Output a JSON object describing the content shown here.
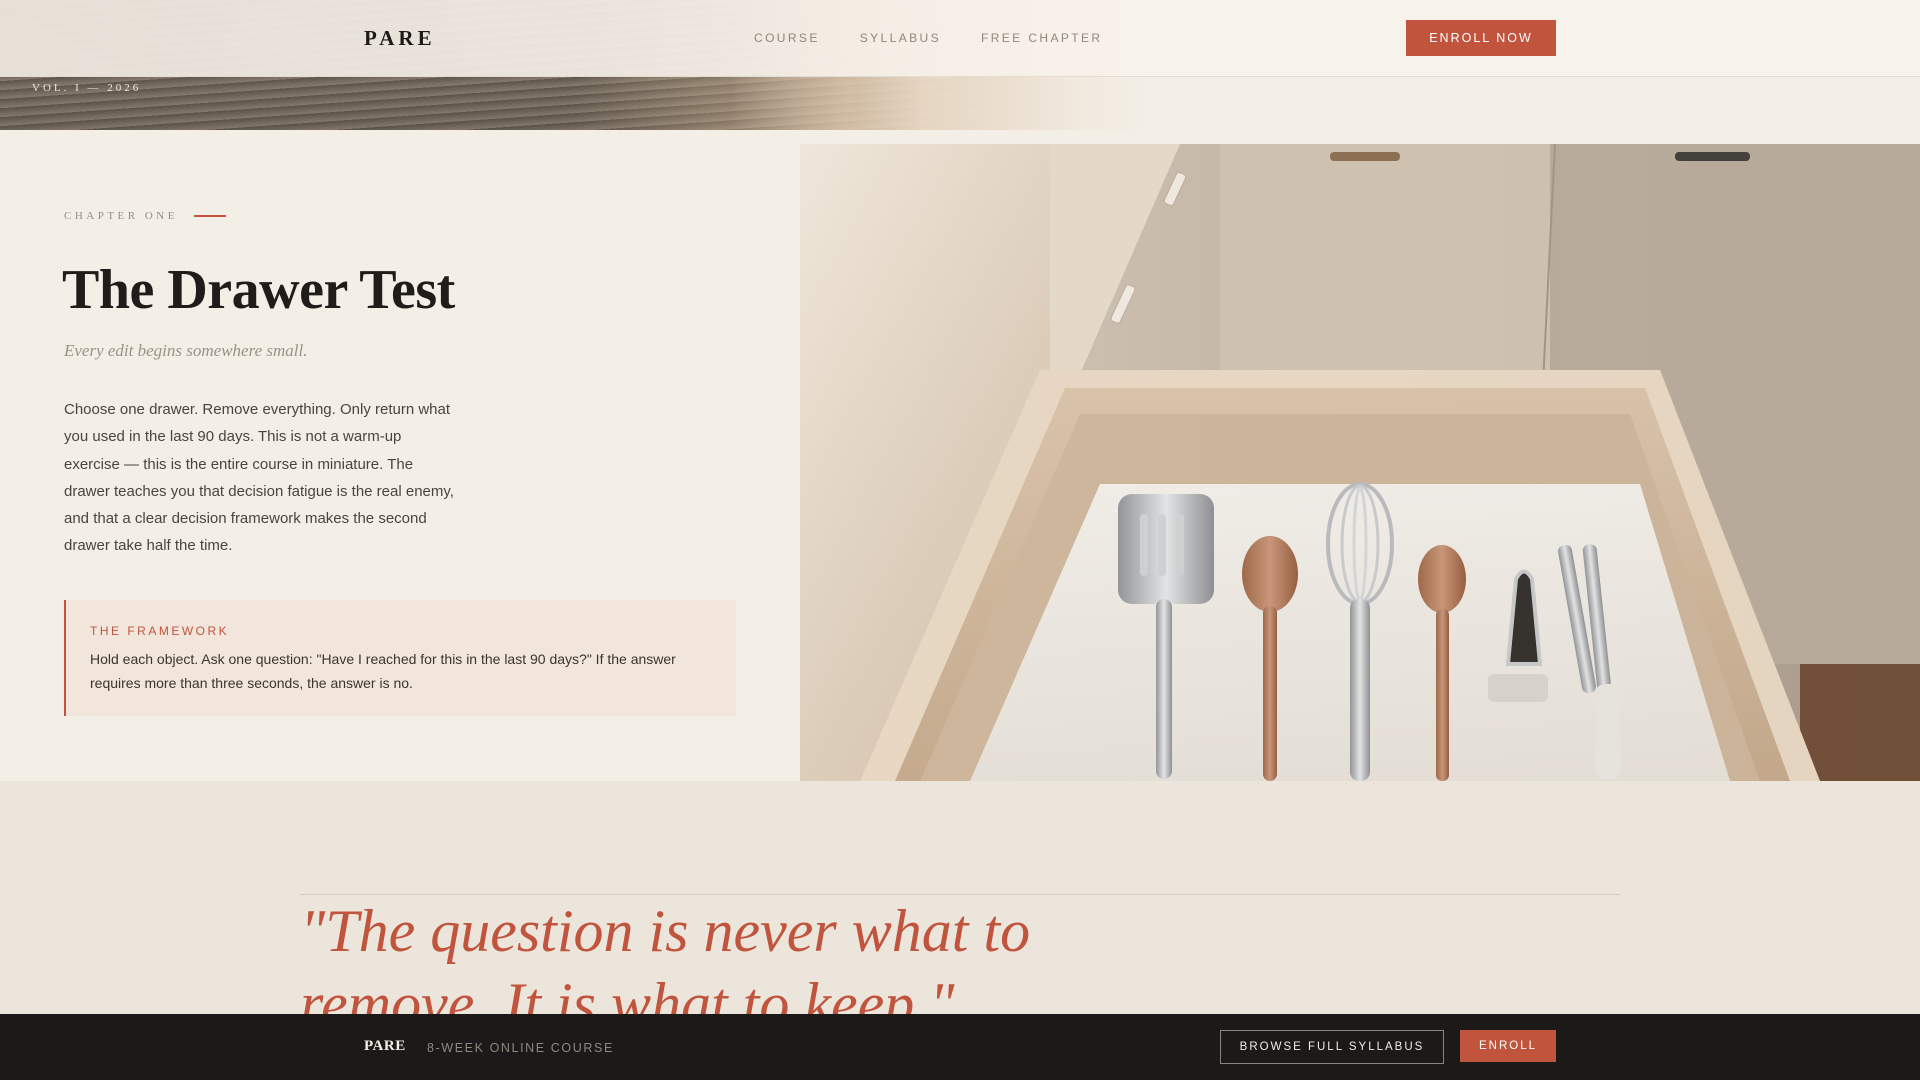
{
  "brand": {
    "logo": "PARE",
    "vol_label": "VOL. I — 2026"
  },
  "nav": {
    "items": [
      {
        "label": "COURSE"
      },
      {
        "label": "SYLLABUS"
      },
      {
        "label": "FREE CHAPTER"
      }
    ],
    "cta": "ENROLL NOW"
  },
  "hero": {
    "eyebrow": "CHAPTER ONE",
    "title": "The Drawer Test",
    "subtitle": "Every edit begins somewhere small.",
    "body": "Choose one drawer. Remove everything. Only return what you used in the last 90 days. This is not a warm-up exercise — this is the entire course in miniature. The drawer teaches you that decision fatigue is the real enemy, and that a clear decision framework makes the second drawer take half the time.",
    "framework": {
      "label": "THE FRAMEWORK",
      "text": "Hold each object. Ask one question: \"Have I reached for this in the last 90 days?\" If the answer requires more than three seconds, the answer is no."
    }
  },
  "quote": {
    "text": "\"The question is never what to remove. It is what to keep.\""
  },
  "sticky_bar": {
    "logo": "PARE",
    "tagline": "8-WEEK ONLINE COURSE",
    "browse_label": "BROWSE FULL SYLLABUS",
    "enroll_label": "ENROLL"
  },
  "colors": {
    "accent": "#c0543d",
    "background": "#f3efe7",
    "dark": "#1c1a18"
  }
}
